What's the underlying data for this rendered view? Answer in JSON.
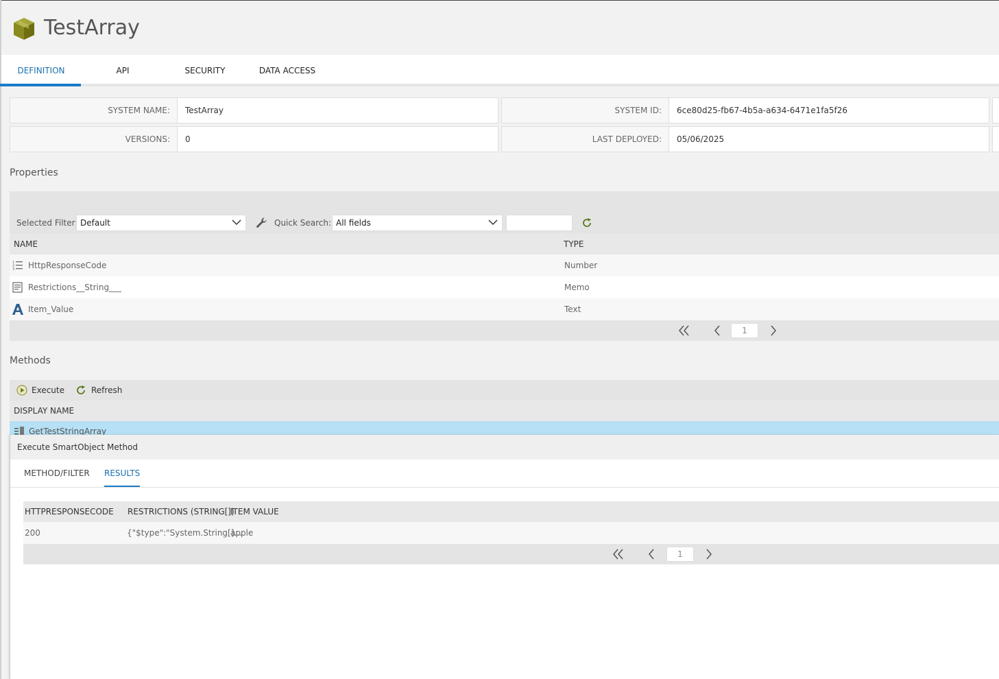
{
  "header": {
    "title": "TestArray",
    "icon": "cube-icon"
  },
  "tabs": [
    {
      "label": "DEFINITION",
      "active": true
    },
    {
      "label": "API",
      "active": false
    },
    {
      "label": "SECURITY",
      "active": false
    },
    {
      "label": "DATA ACCESS",
      "active": false
    }
  ],
  "info": {
    "system_name_label": "SYSTEM NAME:",
    "system_name_value": "TestArray",
    "system_id_label": "SYSTEM ID:",
    "system_id_value": "6ce80d25-fb67-4b5a-a634-6471e1fa5f26",
    "versions_label": "VERSIONS:",
    "versions_value": "0",
    "last_deployed_label": "LAST DEPLOYED:",
    "last_deployed_value": "05/06/2025"
  },
  "properties": {
    "title": "Properties",
    "selected_filter_label": "Selected Filter:",
    "selected_filter_value": "Default",
    "quick_search_label": "Quick Search:",
    "quick_search_value": "All fields",
    "search_text": "",
    "columns": {
      "name": "NAME",
      "type": "TYPE"
    },
    "rows": [
      {
        "name": "HttpResponseCode",
        "type": "Number",
        "icon": "number-list-icon"
      },
      {
        "name": "Restrictions__String___",
        "type": "Memo",
        "icon": "memo-icon"
      },
      {
        "name": "Item_Value",
        "type": "Text",
        "icon": "text-a-icon"
      }
    ],
    "page": "1"
  },
  "methods": {
    "title": "Methods",
    "execute_label": "Execute",
    "refresh_label": "Refresh",
    "column_display_name": "DISPLAY NAME",
    "rows": [
      {
        "name": "GetTestStringArray"
      }
    ]
  },
  "dialog": {
    "title": "Execute SmartObject Method",
    "tabs": [
      {
        "label": "METHOD/FILTER",
        "active": false
      },
      {
        "label": "RESULTS",
        "active": true
      }
    ],
    "columns": {
      "c1": "HTTPRESPONSECODE",
      "c2": "RESTRICTIONS (STRING[])",
      "c3": "ITEM VALUE"
    },
    "rows": [
      {
        "c1": "200",
        "c2": "{\"$type\":\"System.String[]...",
        "c3": "apple"
      }
    ],
    "page": "1"
  },
  "colors": {
    "accent": "#1a7bc7",
    "icon_olive": "#8a8a1e",
    "selected_row": "#b5e0f5"
  }
}
